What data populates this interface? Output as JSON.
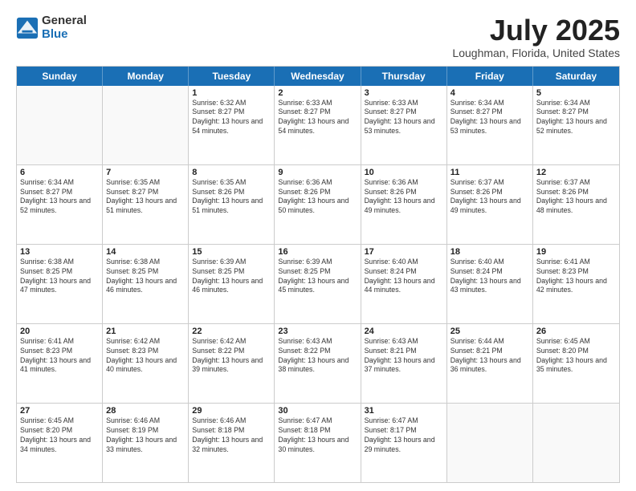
{
  "header": {
    "logo_line1": "General",
    "logo_line2": "Blue",
    "month_year": "July 2025",
    "location": "Loughman, Florida, United States"
  },
  "weekdays": [
    "Sunday",
    "Monday",
    "Tuesday",
    "Wednesday",
    "Thursday",
    "Friday",
    "Saturday"
  ],
  "rows": [
    [
      {
        "day": "",
        "info": ""
      },
      {
        "day": "",
        "info": ""
      },
      {
        "day": "1",
        "info": "Sunrise: 6:32 AM\nSunset: 8:27 PM\nDaylight: 13 hours and 54 minutes."
      },
      {
        "day": "2",
        "info": "Sunrise: 6:33 AM\nSunset: 8:27 PM\nDaylight: 13 hours and 54 minutes."
      },
      {
        "day": "3",
        "info": "Sunrise: 6:33 AM\nSunset: 8:27 PM\nDaylight: 13 hours and 53 minutes."
      },
      {
        "day": "4",
        "info": "Sunrise: 6:34 AM\nSunset: 8:27 PM\nDaylight: 13 hours and 53 minutes."
      },
      {
        "day": "5",
        "info": "Sunrise: 6:34 AM\nSunset: 8:27 PM\nDaylight: 13 hours and 52 minutes."
      }
    ],
    [
      {
        "day": "6",
        "info": "Sunrise: 6:34 AM\nSunset: 8:27 PM\nDaylight: 13 hours and 52 minutes."
      },
      {
        "day": "7",
        "info": "Sunrise: 6:35 AM\nSunset: 8:27 PM\nDaylight: 13 hours and 51 minutes."
      },
      {
        "day": "8",
        "info": "Sunrise: 6:35 AM\nSunset: 8:26 PM\nDaylight: 13 hours and 51 minutes."
      },
      {
        "day": "9",
        "info": "Sunrise: 6:36 AM\nSunset: 8:26 PM\nDaylight: 13 hours and 50 minutes."
      },
      {
        "day": "10",
        "info": "Sunrise: 6:36 AM\nSunset: 8:26 PM\nDaylight: 13 hours and 49 minutes."
      },
      {
        "day": "11",
        "info": "Sunrise: 6:37 AM\nSunset: 8:26 PM\nDaylight: 13 hours and 49 minutes."
      },
      {
        "day": "12",
        "info": "Sunrise: 6:37 AM\nSunset: 8:26 PM\nDaylight: 13 hours and 48 minutes."
      }
    ],
    [
      {
        "day": "13",
        "info": "Sunrise: 6:38 AM\nSunset: 8:25 PM\nDaylight: 13 hours and 47 minutes."
      },
      {
        "day": "14",
        "info": "Sunrise: 6:38 AM\nSunset: 8:25 PM\nDaylight: 13 hours and 46 minutes."
      },
      {
        "day": "15",
        "info": "Sunrise: 6:39 AM\nSunset: 8:25 PM\nDaylight: 13 hours and 46 minutes."
      },
      {
        "day": "16",
        "info": "Sunrise: 6:39 AM\nSunset: 8:25 PM\nDaylight: 13 hours and 45 minutes."
      },
      {
        "day": "17",
        "info": "Sunrise: 6:40 AM\nSunset: 8:24 PM\nDaylight: 13 hours and 44 minutes."
      },
      {
        "day": "18",
        "info": "Sunrise: 6:40 AM\nSunset: 8:24 PM\nDaylight: 13 hours and 43 minutes."
      },
      {
        "day": "19",
        "info": "Sunrise: 6:41 AM\nSunset: 8:23 PM\nDaylight: 13 hours and 42 minutes."
      }
    ],
    [
      {
        "day": "20",
        "info": "Sunrise: 6:41 AM\nSunset: 8:23 PM\nDaylight: 13 hours and 41 minutes."
      },
      {
        "day": "21",
        "info": "Sunrise: 6:42 AM\nSunset: 8:23 PM\nDaylight: 13 hours and 40 minutes."
      },
      {
        "day": "22",
        "info": "Sunrise: 6:42 AM\nSunset: 8:22 PM\nDaylight: 13 hours and 39 minutes."
      },
      {
        "day": "23",
        "info": "Sunrise: 6:43 AM\nSunset: 8:22 PM\nDaylight: 13 hours and 38 minutes."
      },
      {
        "day": "24",
        "info": "Sunrise: 6:43 AM\nSunset: 8:21 PM\nDaylight: 13 hours and 37 minutes."
      },
      {
        "day": "25",
        "info": "Sunrise: 6:44 AM\nSunset: 8:21 PM\nDaylight: 13 hours and 36 minutes."
      },
      {
        "day": "26",
        "info": "Sunrise: 6:45 AM\nSunset: 8:20 PM\nDaylight: 13 hours and 35 minutes."
      }
    ],
    [
      {
        "day": "27",
        "info": "Sunrise: 6:45 AM\nSunset: 8:20 PM\nDaylight: 13 hours and 34 minutes."
      },
      {
        "day": "28",
        "info": "Sunrise: 6:46 AM\nSunset: 8:19 PM\nDaylight: 13 hours and 33 minutes."
      },
      {
        "day": "29",
        "info": "Sunrise: 6:46 AM\nSunset: 8:18 PM\nDaylight: 13 hours and 32 minutes."
      },
      {
        "day": "30",
        "info": "Sunrise: 6:47 AM\nSunset: 8:18 PM\nDaylight: 13 hours and 30 minutes."
      },
      {
        "day": "31",
        "info": "Sunrise: 6:47 AM\nSunset: 8:17 PM\nDaylight: 13 hours and 29 minutes."
      },
      {
        "day": "",
        "info": ""
      },
      {
        "day": "",
        "info": ""
      }
    ]
  ]
}
